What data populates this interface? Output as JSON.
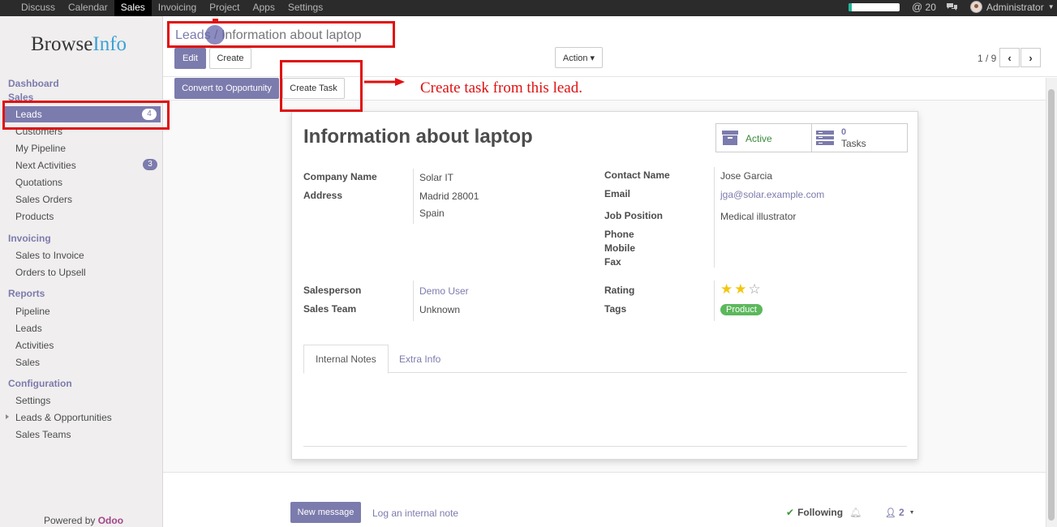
{
  "topbar": {
    "menu": [
      "Discuss",
      "Calendar",
      "Sales",
      "Invoicing",
      "Project",
      "Apps",
      "Settings"
    ],
    "active_menu": "Sales",
    "mentions_symbol": "@",
    "mentions_count": "20",
    "user_name": "Administrator",
    "progress_fraction": 0.06
  },
  "sidebar": {
    "logo_browse": "Browse",
    "logo_info": "Info",
    "dashboard": "Dashboard",
    "sales_section": "Sales",
    "leads": "Leads",
    "leads_badge": "4",
    "customers": "Customers",
    "my_pipeline": "My Pipeline",
    "next_activities": "Next Activities",
    "next_activities_badge": "3",
    "quotations": "Quotations",
    "sales_orders": "Sales Orders",
    "products": "Products",
    "invoicing_section": "Invoicing",
    "sales_to_invoice": "Sales to Invoice",
    "orders_to_upsell": "Orders to Upsell",
    "reports_section": "Reports",
    "rep_pipeline": "Pipeline",
    "rep_leads": "Leads",
    "rep_activities": "Activities",
    "rep_sales": "Sales",
    "configuration_section": "Configuration",
    "settings": "Settings",
    "leads_opportunities": "Leads & Opportunities",
    "sales_teams": "Sales Teams",
    "powered_by": "Powered by ",
    "odoo": "Odoo"
  },
  "control": {
    "breadcrumb_parent": "Leads",
    "breadcrumb_sep": " / ",
    "breadcrumb_current": "Information about laptop",
    "edit": "Edit",
    "create": "Create",
    "action": "Action ▾",
    "pager": "1 / 9",
    "prev": "‹",
    "next": "›"
  },
  "statusbar": {
    "convert": "Convert to Opportunity",
    "create_task": "Create Task"
  },
  "annotation": {
    "text": "Create task from this lead."
  },
  "form": {
    "title": "Information about laptop",
    "active": "Active",
    "tasks_count": "0",
    "tasks_label": "Tasks",
    "company_name_label": "Company Name",
    "company_name": "Solar IT",
    "address_label": "Address",
    "address_line1": "Madrid 28001",
    "address_line2": "Spain",
    "contact_name_label": "Contact Name",
    "contact_name": "Jose Garcia",
    "email_label": "Email",
    "email": "jga@solar.example.com",
    "job_position_label": "Job Position",
    "job_position": "Medical illustrator",
    "phone_label": "Phone",
    "mobile_label": "Mobile",
    "fax_label": "Fax",
    "salesperson_label": "Salesperson",
    "salesperson": "Demo User",
    "sales_team_label": "Sales Team",
    "sales_team": "Unknown",
    "rating_label": "Rating",
    "rating_value": 2,
    "rating_max": 3,
    "tags_label": "Tags",
    "tag": "Product",
    "tab_internal_notes": "Internal Notes",
    "tab_extra_info": "Extra Info"
  },
  "chatter": {
    "new_message": "New message",
    "log_note": "Log an internal note",
    "following": "Following",
    "followers_count": "2"
  },
  "colors": {
    "accent": "#7c7bad",
    "annotation_red": "#e01010",
    "tag_green": "#5cb85c",
    "star_gold": "#f3c610"
  }
}
